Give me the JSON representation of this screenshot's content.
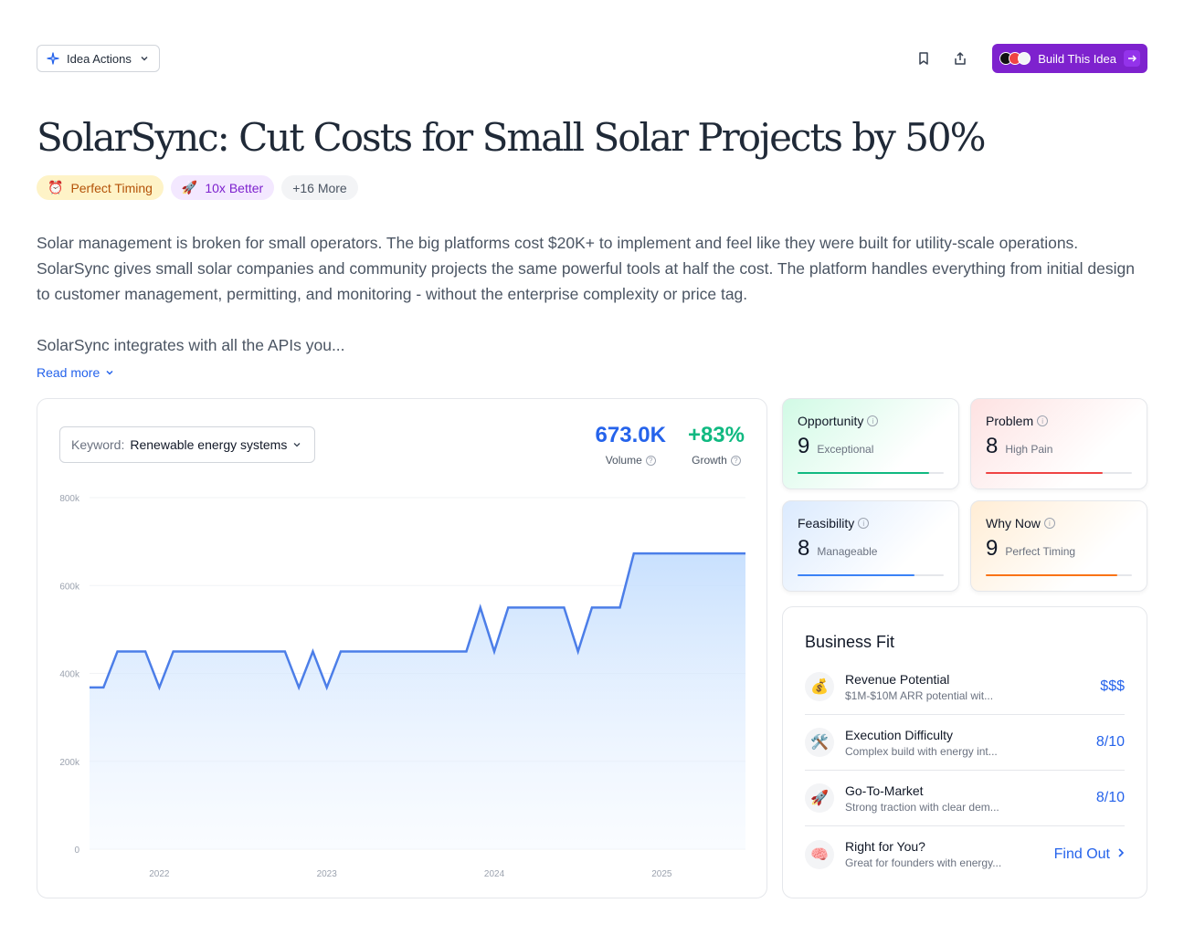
{
  "header": {
    "actions_label": "Idea Actions",
    "build_label": "Build This Idea"
  },
  "title": "SolarSync: Cut Costs for Small Solar Projects by 50%",
  "tags": [
    {
      "emoji": "⏰",
      "label": "Perfect Timing"
    },
    {
      "emoji": "🚀",
      "label": "10x Better"
    },
    {
      "label": "+16 More"
    }
  ],
  "description": {
    "p1": "Solar management is broken for small operators. The big platforms cost $20K+ to implement and feel like they were built for utility-scale operations. SolarSync gives small solar companies and community projects the same powerful tools at half the cost. The platform handles everything from initial design to customer management, permitting, and monitoring - without the enterprise complexity or price tag.",
    "p2": "SolarSync integrates with all the APIs you...",
    "read_more": "Read more"
  },
  "keyword": {
    "label": "Keyword:",
    "value": "Renewable energy systems"
  },
  "stats": {
    "volume": {
      "value": "673.0K",
      "label": "Volume"
    },
    "growth": {
      "value": "+83%",
      "label": "Growth"
    }
  },
  "chart_data": {
    "type": "area",
    "x": [
      "2021-08",
      "2021-09",
      "2021-10",
      "2021-11",
      "2021-12",
      "2022-01",
      "2022-02",
      "2022-03",
      "2022-04",
      "2022-05",
      "2022-06",
      "2022-07",
      "2022-08",
      "2022-09",
      "2022-10",
      "2022-11",
      "2022-12",
      "2023-01",
      "2023-02",
      "2023-03",
      "2023-04",
      "2023-05",
      "2023-06",
      "2023-07",
      "2023-08",
      "2023-09",
      "2023-10",
      "2023-11",
      "2023-12",
      "2024-01",
      "2024-02",
      "2024-03",
      "2024-04",
      "2024-05",
      "2024-06",
      "2024-07",
      "2024-08",
      "2024-09",
      "2024-10",
      "2024-11",
      "2024-12",
      "2025-01",
      "2025-02",
      "2025-03",
      "2025-04",
      "2025-05",
      "2025-06",
      "2025-07"
    ],
    "values": [
      368000,
      368000,
      450000,
      450000,
      450000,
      368000,
      450000,
      450000,
      450000,
      450000,
      450000,
      450000,
      450000,
      450000,
      450000,
      368000,
      450000,
      368000,
      450000,
      450000,
      450000,
      450000,
      450000,
      450000,
      450000,
      450000,
      450000,
      450000,
      550000,
      450000,
      550000,
      550000,
      550000,
      550000,
      550000,
      450000,
      550000,
      550000,
      550000,
      673000,
      673000,
      673000,
      673000,
      673000,
      673000,
      673000,
      673000,
      673000
    ],
    "ytick_labels": [
      "0",
      "200k",
      "400k",
      "600k",
      "800k"
    ],
    "yticks": [
      0,
      200000,
      400000,
      600000,
      800000
    ],
    "ylim": [
      0,
      800000
    ],
    "xtick_labels": [
      "2022",
      "2023",
      "2024",
      "2025"
    ],
    "xtick_positions": [
      "2022-01",
      "2023-01",
      "2024-01",
      "2025-01"
    ],
    "grid": true,
    "color": "#4c7ee8"
  },
  "scores": {
    "opportunity": {
      "title": "Opportunity",
      "score": "9",
      "desc": "Exceptional",
      "fraction": 0.9,
      "color": "#10b981"
    },
    "problem": {
      "title": "Problem",
      "score": "8",
      "desc": "High Pain",
      "fraction": 0.8,
      "color": "#ef4444"
    },
    "feasibility": {
      "title": "Feasibility",
      "score": "8",
      "desc": "Manageable",
      "fraction": 0.8,
      "color": "#3b82f6"
    },
    "why_now": {
      "title": "Why Now",
      "score": "9",
      "desc": "Perfect Timing",
      "fraction": 0.9,
      "color": "#f97316"
    }
  },
  "business_fit": {
    "title": "Business Fit",
    "items": [
      {
        "emoji": "💰",
        "name": "Revenue Potential",
        "sub": "$1M-$10M ARR potential wit...",
        "value": "$$$"
      },
      {
        "emoji": "🛠️",
        "name": "Execution Difficulty",
        "sub": "Complex build with energy int...",
        "value": "8/10"
      },
      {
        "emoji": "🚀",
        "name": "Go-To-Market",
        "sub": "Strong traction with clear dem...",
        "value": "8/10"
      },
      {
        "emoji": "🧠",
        "name": "Right for You?",
        "sub": "Great for founders with energy...",
        "value": "Find Out"
      }
    ]
  },
  "colors": {
    "accent": "#7e22ce",
    "link": "#2563eb",
    "growth": "#10b981"
  }
}
